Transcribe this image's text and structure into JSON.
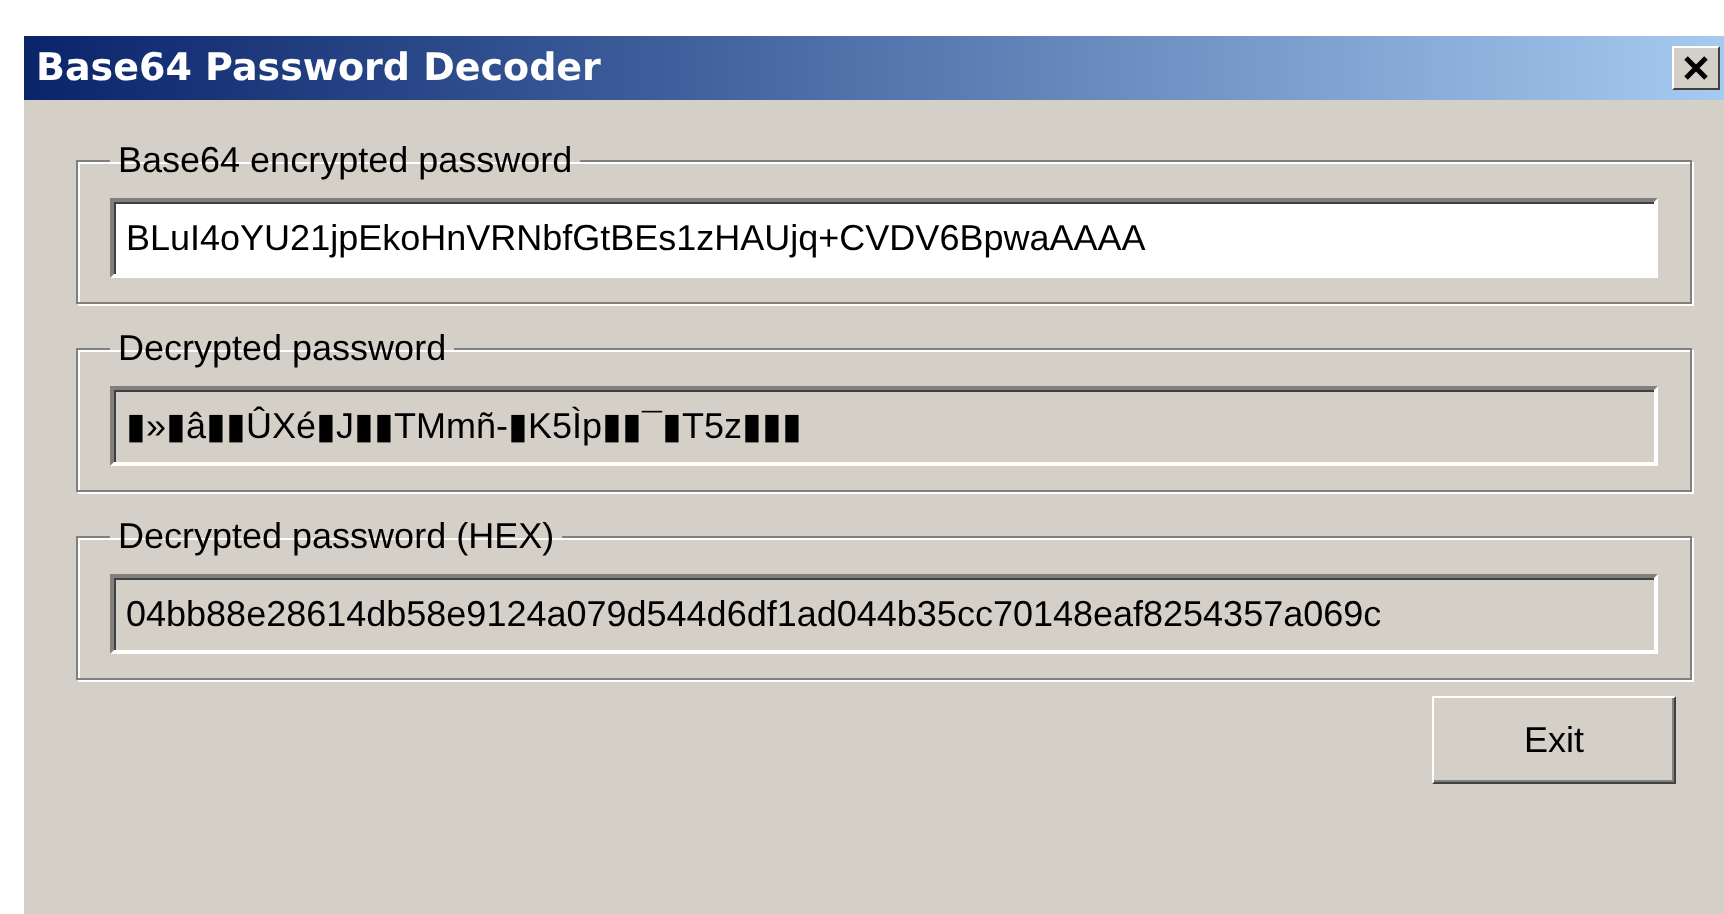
{
  "window": {
    "title": "Base64 Password Decoder"
  },
  "groups": [
    {
      "label": "Base64 encrypted password",
      "value": "BLuI4oYU21jpEkoHnVRNbfGtBEs1zHAUjq+CVDV6BpwaAAAA",
      "disabled": false
    },
    {
      "label": "Decrypted password",
      "value": "▮»▮â▮▮ÛXé▮J▮▮TMmñ-▮K5Ìp▮▮¯▮T5z▮▮▮",
      "disabled": true
    },
    {
      "label": "Decrypted password (HEX)",
      "value": "04bb88e28614db58e9124a079d544d6df1ad044b35cc70148eaf8254357a069c",
      "disabled": true
    }
  ],
  "buttons": [
    "Exit"
  ]
}
